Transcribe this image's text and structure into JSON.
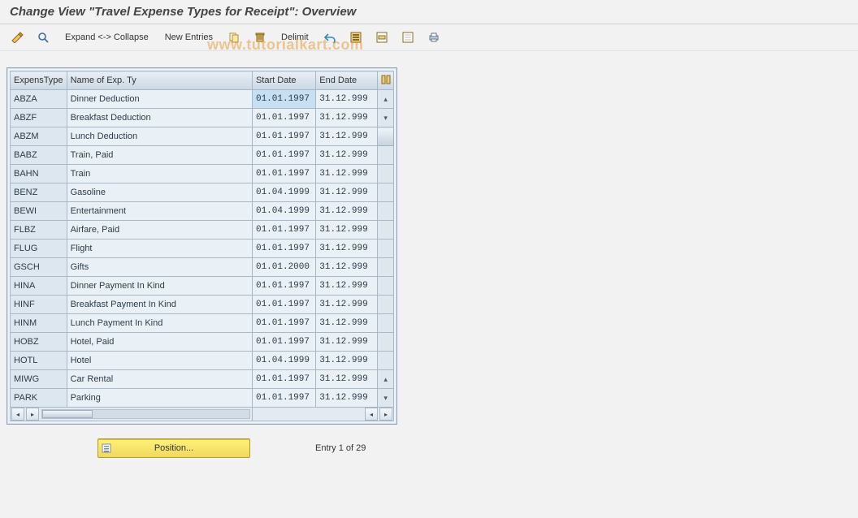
{
  "title": "Change View \"Travel Expense Types for Receipt\": Overview",
  "watermark": "www.tutorialkart.com",
  "toolbar": {
    "expand_collapse": "Expand <-> Collapse",
    "new_entries": "New Entries",
    "delimit": "Delimit"
  },
  "table": {
    "headers": {
      "expense_type": "ExpensType",
      "name": "Name of Exp. Ty",
      "start_date": "Start Date",
      "end_date": "End Date"
    },
    "rows": [
      {
        "code": "ABZA",
        "name": "Dinner Deduction",
        "start": "01.01.1997",
        "end": "31.12.999",
        "selected": true
      },
      {
        "code": "ABZF",
        "name": "Breakfast Deduction",
        "start": "01.01.1997",
        "end": "31.12.999"
      },
      {
        "code": "ABZM",
        "name": "Lunch Deduction",
        "start": "01.01.1997",
        "end": "31.12.999"
      },
      {
        "code": "BABZ",
        "name": "Train, Paid",
        "start": "01.01.1997",
        "end": "31.12.999"
      },
      {
        "code": "BAHN",
        "name": "Train",
        "start": "01.01.1997",
        "end": "31.12.999"
      },
      {
        "code": "BENZ",
        "name": "Gasoline",
        "start": "01.04.1999",
        "end": "31.12.999"
      },
      {
        "code": "BEWI",
        "name": "Entertainment",
        "start": "01.04.1999",
        "end": "31.12.999"
      },
      {
        "code": "FLBZ",
        "name": "Airfare, Paid",
        "start": "01.01.1997",
        "end": "31.12.999"
      },
      {
        "code": "FLUG",
        "name": "Flight",
        "start": "01.01.1997",
        "end": "31.12.999"
      },
      {
        "code": "GSCH",
        "name": "Gifts",
        "start": "01.01.2000",
        "end": "31.12.999"
      },
      {
        "code": "HINA",
        "name": "Dinner Payment In Kind",
        "start": "01.01.1997",
        "end": "31.12.999"
      },
      {
        "code": "HINF",
        "name": "Breakfast Payment In Kind",
        "start": "01.01.1997",
        "end": "31.12.999"
      },
      {
        "code": "HINM",
        "name": "Lunch Payment In Kind",
        "start": "01.01.1997",
        "end": "31.12.999"
      },
      {
        "code": "HOBZ",
        "name": "Hotel, Paid",
        "start": "01.01.1997",
        "end": "31.12.999"
      },
      {
        "code": "HOTL",
        "name": "Hotel",
        "start": "01.04.1999",
        "end": "31.12.999"
      },
      {
        "code": "MIWG",
        "name": "Car Rental",
        "start": "01.01.1997",
        "end": "31.12.999"
      },
      {
        "code": "PARK",
        "name": "Parking",
        "start": "01.01.1997",
        "end": "31.12.999"
      }
    ]
  },
  "footer": {
    "position_label": "Position...",
    "entry_text": "Entry 1 of 29"
  }
}
